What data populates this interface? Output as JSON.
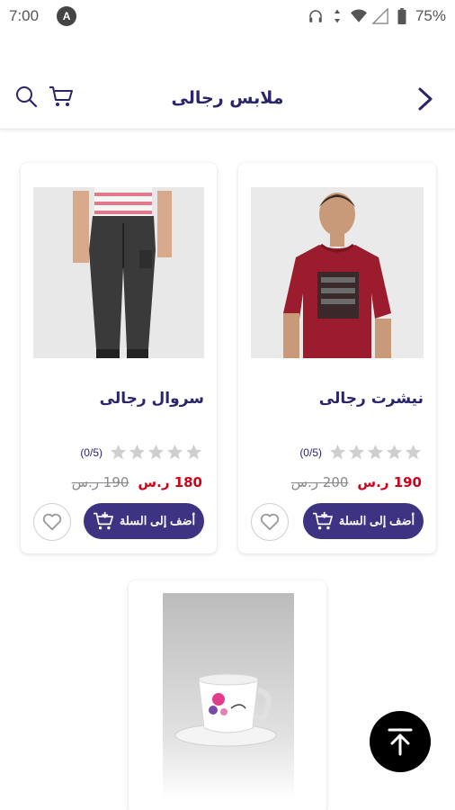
{
  "status_bar": {
    "time": "7:00",
    "notification_icon": "a-circle-icon",
    "battery": "75%"
  },
  "header": {
    "title": "ملابس رجالى",
    "icons": [
      "search-icon",
      "cart-icon",
      "chevron-right-icon"
    ]
  },
  "products": [
    {
      "name": "نيشرت رجالى",
      "rating_text": "(0/5)",
      "rating_value": 0,
      "price_new": "190 ر.س",
      "price_old": "200 ر.س",
      "add_label": "أضف إلى السلة"
    },
    {
      "name": "سروال رجالى",
      "rating_text": "(0/5)",
      "rating_value": 0,
      "price_new": "180 ر.س",
      "price_old": "190 ر.س",
      "add_label": "أضف إلى السلة"
    },
    {
      "image": "mug-product-image"
    }
  ],
  "colors": {
    "primary": "#3d3383",
    "title": "#2a2468",
    "price_new": "#d0021b",
    "star": "#cfcfcf"
  }
}
